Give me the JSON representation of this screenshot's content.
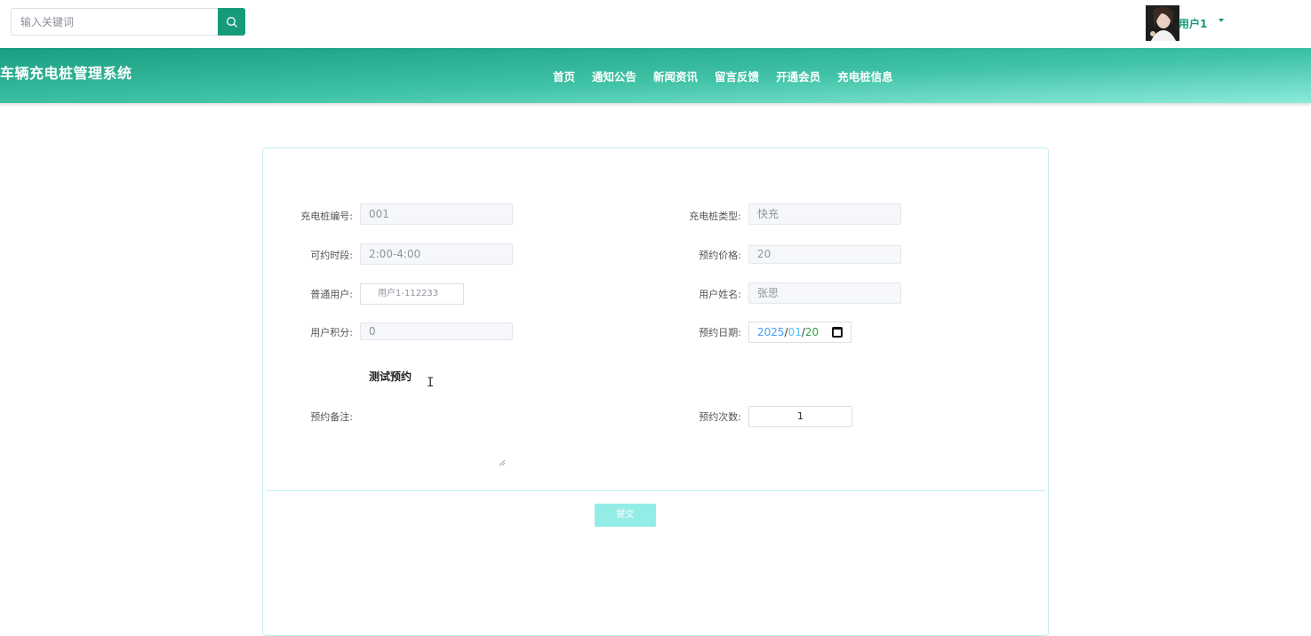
{
  "search": {
    "placeholder": "输入关键词"
  },
  "user": {
    "name": "用户1"
  },
  "header": {
    "title": "车辆充电桩管理系统",
    "nav": [
      "首页",
      "通知公告",
      "新闻资讯",
      "留言反馈",
      "开通会员",
      "充电桩信息"
    ]
  },
  "form": {
    "pile_no": {
      "label": "充电桩编号:",
      "value": "001"
    },
    "pile_type": {
      "label": "充电桩类型:",
      "value": "快充"
    },
    "time_slot": {
      "label": "可约时段:",
      "value": "2:00-4:00"
    },
    "price": {
      "label": "预约价格:",
      "value": "20"
    },
    "user_account": {
      "label": "普通用户:",
      "value": "用户1-112233"
    },
    "user_name": {
      "label": "用户姓名:",
      "value": "张思"
    },
    "points": {
      "label": "用户积分:",
      "value": "0"
    },
    "date": {
      "label": "预约日期:",
      "year": "2025",
      "month": "01",
      "day": "20",
      "sep": "/"
    },
    "remark": {
      "label": "预约备注:",
      "value": "测试预约"
    },
    "count": {
      "label": "预约次数:",
      "value": "1"
    },
    "submit_label": "提交"
  },
  "colors": {
    "accent": "#159a7b",
    "nav_start": "#1a9c80",
    "nav_end": "#8ceadb",
    "submit": "#93ece6"
  }
}
